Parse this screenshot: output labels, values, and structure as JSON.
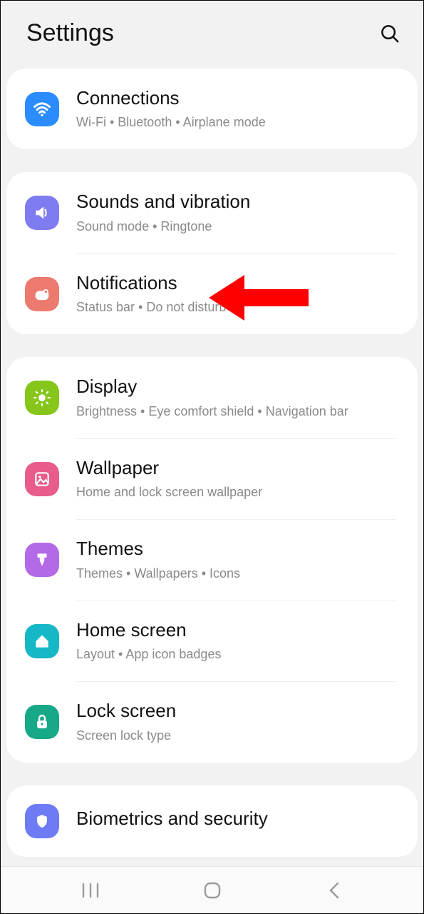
{
  "header": {
    "title": "Settings"
  },
  "groups": [
    {
      "items": [
        {
          "key": "connections",
          "title": "Connections",
          "subtitle": "Wi-Fi  •  Bluetooth  •  Airplane mode",
          "color": "#2a8cff"
        }
      ]
    },
    {
      "items": [
        {
          "key": "sounds",
          "title": "Sounds and vibration",
          "subtitle": "Sound mode  •  Ringtone",
          "color": "#7f7bf0"
        },
        {
          "key": "notifications",
          "title": "Notifications",
          "subtitle": "Status bar  •  Do not disturb",
          "color": "#ec7a6e"
        }
      ]
    },
    {
      "items": [
        {
          "key": "display",
          "title": "Display",
          "subtitle": "Brightness  •  Eye comfort shield  •  Navigation bar",
          "color": "#86c61a"
        },
        {
          "key": "wallpaper",
          "title": "Wallpaper",
          "subtitle": "Home and lock screen wallpaper",
          "color": "#e85b8a"
        },
        {
          "key": "themes",
          "title": "Themes",
          "subtitle": "Themes  •  Wallpapers  •  Icons",
          "color": "#b36ae6"
        },
        {
          "key": "homescreen",
          "title": "Home screen",
          "subtitle": "Layout  •  App icon badges",
          "color": "#16b7c6"
        },
        {
          "key": "lockscreen",
          "title": "Lock screen",
          "subtitle": "Screen lock type",
          "color": "#17a887"
        }
      ]
    },
    {
      "items": [
        {
          "key": "biometrics",
          "title": "Biometrics and security",
          "subtitle": "",
          "color": "#6d7cf4"
        }
      ]
    }
  ],
  "annotation": {
    "target": "notifications",
    "color": "#ff0000"
  }
}
